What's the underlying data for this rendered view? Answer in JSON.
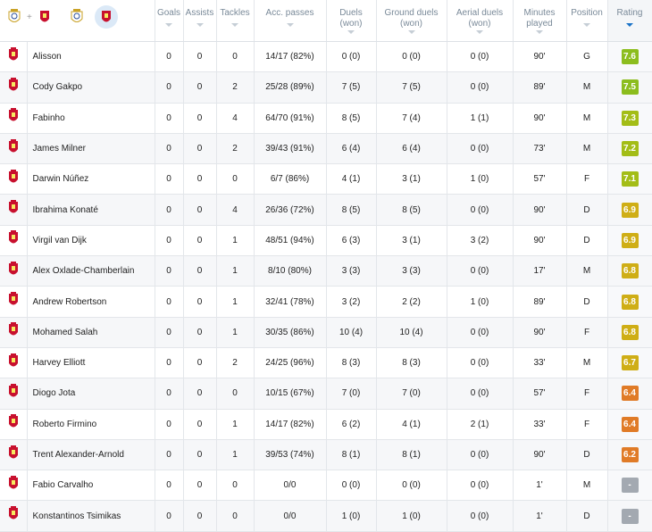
{
  "header": {
    "goals": "Goals",
    "assists": "Assists",
    "tackles": "Tackles",
    "acc_passes": "Acc. passes",
    "duels_1": "Duels",
    "duels_2": "(won)",
    "ground_1": "Ground duels",
    "ground_2": "(won)",
    "aerial_1": "Aerial duels",
    "aerial_2": "(won)",
    "minutes_1": "Minutes",
    "minutes_2": "played",
    "position": "Position",
    "rating": "Rating",
    "team_toggle_plus": "+"
  },
  "colors": {
    "rating_green_bright": "#8cbd1e",
    "rating_green": "#a9bd17",
    "rating_yellow": "#cfae16",
    "rating_orange": "#e07b27",
    "rating_none": "#a3a9b1",
    "sort_active": "#1a73c7"
  },
  "players": [
    {
      "name": "Alisson",
      "goals": "0",
      "assists": "0",
      "tackles": "0",
      "passes": "14/17 (82%)",
      "duels": "0 (0)",
      "ground": "0 (0)",
      "aerial": "0 (0)",
      "minutes": "90'",
      "position": "G",
      "rating": "7.6",
      "rating_color": "#8cbd1e"
    },
    {
      "name": "Cody Gakpo",
      "goals": "0",
      "assists": "0",
      "tackles": "2",
      "passes": "25/28 (89%)",
      "duels": "7 (5)",
      "ground": "7 (5)",
      "aerial": "0 (0)",
      "minutes": "89'",
      "position": "M",
      "rating": "7.5",
      "rating_color": "#8cbd1e"
    },
    {
      "name": "Fabinho",
      "goals": "0",
      "assists": "0",
      "tackles": "4",
      "passes": "64/70 (91%)",
      "duels": "8 (5)",
      "ground": "7 (4)",
      "aerial": "1 (1)",
      "minutes": "90'",
      "position": "M",
      "rating": "7.3",
      "rating_color": "#a3bd17"
    },
    {
      "name": "James Milner",
      "goals": "0",
      "assists": "0",
      "tackles": "2",
      "passes": "39/43 (91%)",
      "duels": "6 (4)",
      "ground": "6 (4)",
      "aerial": "0 (0)",
      "minutes": "73'",
      "position": "M",
      "rating": "7.2",
      "rating_color": "#a3bd17"
    },
    {
      "name": "Darwin Núñez",
      "goals": "0",
      "assists": "0",
      "tackles": "0",
      "passes": "6/7 (86%)",
      "duels": "4 (1)",
      "ground": "3 (1)",
      "aerial": "1 (0)",
      "minutes": "57'",
      "position": "F",
      "rating": "7.1",
      "rating_color": "#a3bd17"
    },
    {
      "name": "Ibrahima Konaté",
      "goals": "0",
      "assists": "0",
      "tackles": "4",
      "passes": "26/36 (72%)",
      "duels": "8 (5)",
      "ground": "8 (5)",
      "aerial": "0 (0)",
      "minutes": "90'",
      "position": "D",
      "rating": "6.9",
      "rating_color": "#cfae16"
    },
    {
      "name": "Virgil van Dijk",
      "goals": "0",
      "assists": "0",
      "tackles": "1",
      "passes": "48/51 (94%)",
      "duels": "6 (3)",
      "ground": "3 (1)",
      "aerial": "3 (2)",
      "minutes": "90'",
      "position": "D",
      "rating": "6.9",
      "rating_color": "#cfae16"
    },
    {
      "name": "Alex Oxlade-Chamberlain",
      "goals": "0",
      "assists": "0",
      "tackles": "1",
      "passes": "8/10 (80%)",
      "duels": "3 (3)",
      "ground": "3 (3)",
      "aerial": "0 (0)",
      "minutes": "17'",
      "position": "M",
      "rating": "6.8",
      "rating_color": "#cfae16"
    },
    {
      "name": "Andrew Robertson",
      "goals": "0",
      "assists": "0",
      "tackles": "1",
      "passes": "32/41 (78%)",
      "duels": "3 (2)",
      "ground": "2 (2)",
      "aerial": "1 (0)",
      "minutes": "89'",
      "position": "D",
      "rating": "6.8",
      "rating_color": "#cfae16"
    },
    {
      "name": "Mohamed Salah",
      "goals": "0",
      "assists": "0",
      "tackles": "1",
      "passes": "30/35 (86%)",
      "duels": "10 (4)",
      "ground": "10 (4)",
      "aerial": "0 (0)",
      "minutes": "90'",
      "position": "F",
      "rating": "6.8",
      "rating_color": "#cfae16"
    },
    {
      "name": "Harvey Elliott",
      "goals": "0",
      "assists": "0",
      "tackles": "2",
      "passes": "24/25 (96%)",
      "duels": "8 (3)",
      "ground": "8 (3)",
      "aerial": "0 (0)",
      "minutes": "33'",
      "position": "M",
      "rating": "6.7",
      "rating_color": "#cfae16"
    },
    {
      "name": "Diogo Jota",
      "goals": "0",
      "assists": "0",
      "tackles": "0",
      "passes": "10/15 (67%)",
      "duels": "7 (0)",
      "ground": "7 (0)",
      "aerial": "0 (0)",
      "minutes": "57'",
      "position": "F",
      "rating": "6.4",
      "rating_color": "#e07b27"
    },
    {
      "name": "Roberto Firmino",
      "goals": "0",
      "assists": "0",
      "tackles": "1",
      "passes": "14/17 (82%)",
      "duels": "6 (2)",
      "ground": "4 (1)",
      "aerial": "2 (1)",
      "minutes": "33'",
      "position": "F",
      "rating": "6.4",
      "rating_color": "#e07b27"
    },
    {
      "name": "Trent Alexander-Arnold",
      "goals": "0",
      "assists": "0",
      "tackles": "1",
      "passes": "39/53 (74%)",
      "duels": "8 (1)",
      "ground": "8 (1)",
      "aerial": "0 (0)",
      "minutes": "90'",
      "position": "D",
      "rating": "6.2",
      "rating_color": "#e07b27"
    },
    {
      "name": "Fabio Carvalho",
      "goals": "0",
      "assists": "0",
      "tackles": "0",
      "passes": "0/0",
      "duels": "0 (0)",
      "ground": "0 (0)",
      "aerial": "0 (0)",
      "minutes": "1'",
      "position": "M",
      "rating": "-",
      "rating_color": "#a3a9b1"
    },
    {
      "name": "Konstantinos Tsimikas",
      "goals": "0",
      "assists": "0",
      "tackles": "0",
      "passes": "0/0",
      "duels": "1 (0)",
      "ground": "1 (0)",
      "aerial": "0 (0)",
      "minutes": "1'",
      "position": "D",
      "rating": "-",
      "rating_color": "#a3a9b1"
    }
  ]
}
